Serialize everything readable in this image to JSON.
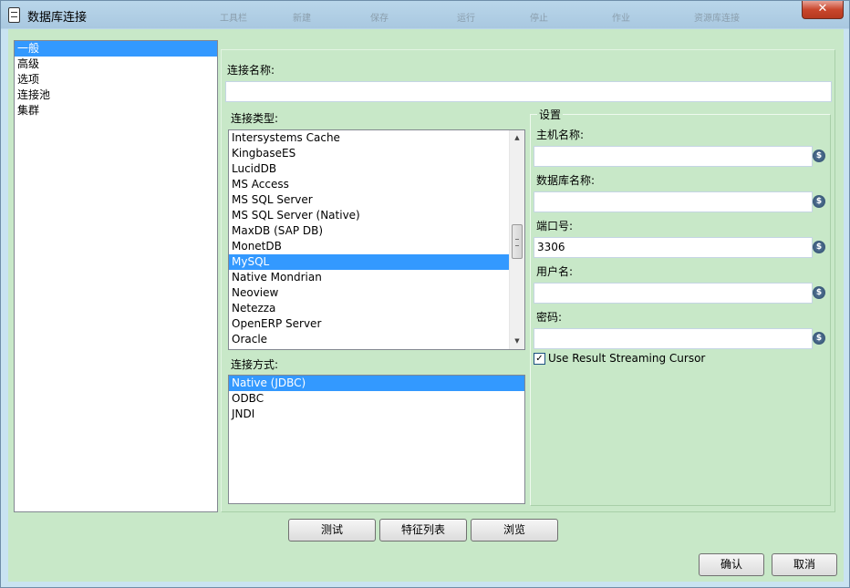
{
  "window": {
    "title": "数据库连接",
    "close_label": "✕",
    "background_toolbar_labels": [
      "工具栏",
      "新建",
      "保存",
      "运行",
      "停止",
      "作业",
      "资源库连接"
    ]
  },
  "nav": {
    "items": [
      "一般",
      "高级",
      "选项",
      "连接池",
      "集群"
    ],
    "selected_index": 0
  },
  "connection": {
    "name_label": "连接名称:",
    "name_value": "",
    "type_label": "连接类型:",
    "types_visible": [
      "Intersystems Cache",
      "KingbaseES",
      "LucidDB",
      "MS Access",
      "MS SQL Server",
      "MS SQL Server (Native)",
      "MaxDB (SAP DB)",
      "MonetDB",
      "MySQL",
      "Native Mondrian",
      "Neoview",
      "Netezza",
      "OpenERP Server",
      "Oracle"
    ],
    "selected_type": "MySQL",
    "method_label": "连接方式:",
    "methods": [
      "Native (JDBC)",
      "ODBC",
      "JNDI"
    ],
    "selected_method": "Native (JDBC)"
  },
  "settings": {
    "title": "设置",
    "host_label": "主机名称:",
    "host_value": "",
    "db_label": "数据库名称:",
    "db_value": "",
    "port_label": "端口号:",
    "port_value": "3306",
    "user_label": "用户名:",
    "user_value": "",
    "password_label": "密码:",
    "password_value": "",
    "variable_icon": "$",
    "streaming_label": "Use Result Streaming Cursor",
    "streaming_checked": true,
    "checkmark": "✓"
  },
  "buttons": {
    "test": "测试",
    "features": "特征列表",
    "browse": "浏览",
    "ok": "确认",
    "cancel": "取消"
  },
  "colors": {
    "selection": "#3399ff",
    "client_background": "#c8e8c8",
    "close_button": "#c9462c"
  },
  "icons": {
    "app": "database-icon",
    "close": "close-icon",
    "variable": "variable-icon",
    "scroll_up": "chevron-up-icon",
    "scroll_down": "chevron-down-icon"
  }
}
